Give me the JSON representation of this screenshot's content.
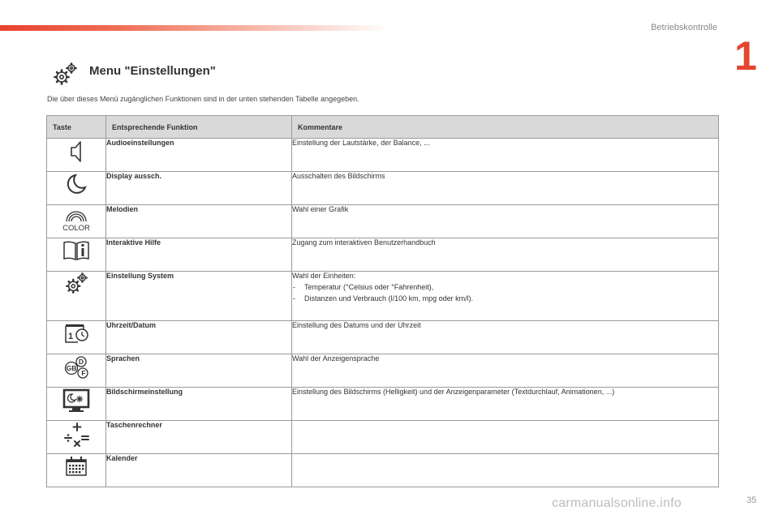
{
  "header": {
    "section": "Betriebskontrolle",
    "chapter": "1"
  },
  "title": "Menu \"Einstellungen\"",
  "intro": "Die über dieses Menü zugänglichen Funktionen sind in der unten stehenden Tabelle angegeben.",
  "table": {
    "headers": {
      "key": "Taste",
      "function": "Entsprechende Funktion",
      "comment": "Kommentare"
    },
    "rows": [
      {
        "icon": "speaker-icon",
        "function": "Audioeinstellungen",
        "comment": "Einstellung der Lautstärke, der Balance, ..."
      },
      {
        "icon": "moon-icon",
        "function": "Display aussch.",
        "comment": "Ausschalten des Bildschirms"
      },
      {
        "icon": "color-icon",
        "icon_text": "COLOR",
        "function": "Melodien",
        "comment": "Wahl einer Grafik"
      },
      {
        "icon": "help-book-icon",
        "function": "Interaktive Hilfe",
        "comment": "Zugang zum interaktiven Benutzerhandbuch"
      },
      {
        "icon": "gears-icon",
        "function": "Einstellung System",
        "comment": "Wahl der Einheiten:",
        "bullets": [
          "Temperatur (°Celsius oder °Fahrenheit),",
          "Distanzen und Verbrauch (l/100 km, mpg oder km/l)."
        ]
      },
      {
        "icon": "clock-calendar-icon",
        "icon_text": "1",
        "function": "Uhrzeit/Datum",
        "comment": "Einstellung des Datums und der Uhrzeit"
      },
      {
        "icon": "languages-icon",
        "icon_text": [
          "D",
          "GB",
          "F"
        ],
        "function": "Sprachen",
        "comment": "Wahl der Anzeigensprache"
      },
      {
        "icon": "screen-settings-icon",
        "function": "Bildschirmeinstellung",
        "comment": "Einstellung des Bildschirms (Helligkeit) und der Anzeigenparameter (Textdurchlauf, Animationen, ...)"
      },
      {
        "icon": "calculator-icon",
        "function": "Taschenrechner",
        "comment": ""
      },
      {
        "icon": "calendar-icon",
        "function": "Kalender",
        "comment": ""
      }
    ]
  },
  "footer": {
    "page_number": "35",
    "watermark": "carmanualsonline.info"
  },
  "colors": {
    "accent": "#e3452e",
    "header_bg": "#d9d9d9",
    "border": "#9a9a9a"
  }
}
